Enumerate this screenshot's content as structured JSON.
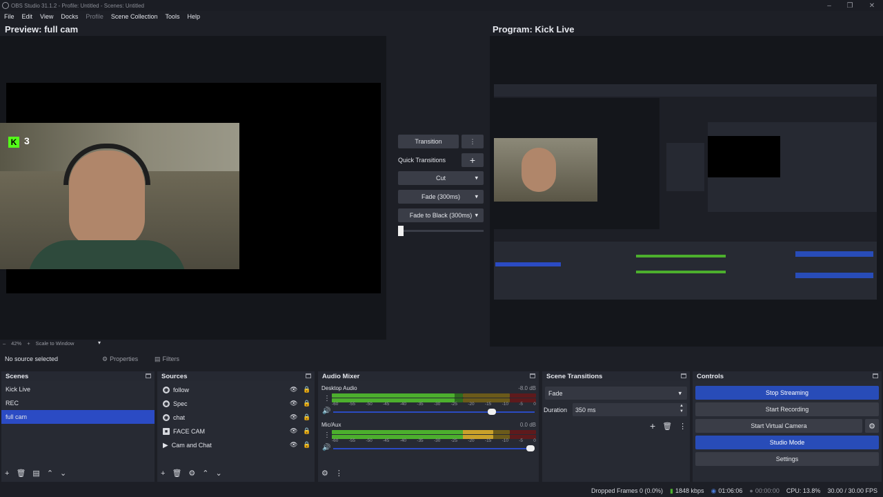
{
  "window": {
    "title": "OBS Studio 31.1.2 - Profile: Untitled - Scenes: Untitled"
  },
  "menu": {
    "items": [
      "File",
      "Edit",
      "View",
      "Docks",
      "Profile",
      "Scene Collection",
      "Tools",
      "Help"
    ]
  },
  "preview": {
    "label": "Preview: full cam",
    "zoom": "42%",
    "scale_mode": "Scale to Window",
    "overlay_count": "3"
  },
  "program": {
    "label": "Program: Kick Live"
  },
  "transitions_center": {
    "transition_button": "Transition",
    "quick_transitions_label": "Quick Transitions",
    "items": [
      "Cut",
      "Fade (300ms)",
      "Fade to Black (300ms)"
    ],
    "tbar_level": 0.0
  },
  "source_toolbar": {
    "status": "No source selected",
    "properties": "Properties",
    "filters": "Filters"
  },
  "scenes": {
    "title": "Scenes",
    "items": [
      "Kick Live",
      "REC",
      "full cam"
    ],
    "selected_index": 2
  },
  "sources": {
    "title": "Sources",
    "items": [
      {
        "name": "follow",
        "icon": "globe-icon"
      },
      {
        "name": "Spec",
        "icon": "globe-icon"
      },
      {
        "name": "chat",
        "icon": "globe-icon"
      },
      {
        "name": "FACE CAM",
        "icon": "camera-icon"
      },
      {
        "name": "Cam and Chat",
        "icon": "group-icon"
      }
    ]
  },
  "audio_mixer": {
    "title": "Audio Mixer",
    "ticks": [
      "-60",
      "-55",
      "-50",
      "-45",
      "-40",
      "-35",
      "-30",
      "-25",
      "-20",
      "-15",
      "-10",
      "-5",
      "0"
    ],
    "channels": [
      {
        "name": "Desktop Audio",
        "db": "-8.0 dB",
        "level": 0.6,
        "volume": 0.8
      },
      {
        "name": "Mic/Aux",
        "db": "0.0 dB",
        "level": 0.79,
        "volume": 1.0
      }
    ],
    "colors": {
      "green": "#4caf2d",
      "yellow": "#c9a12a",
      "red": "#a8262b"
    }
  },
  "scene_transitions": {
    "title": "Scene Transitions",
    "selected": "Fade",
    "duration_label": "Duration",
    "duration_value": "350 ms"
  },
  "controls": {
    "title": "Controls",
    "buttons": [
      {
        "label": "Stop Streaming",
        "active": true
      },
      {
        "label": "Start Recording",
        "active": false
      },
      {
        "label": "Start Virtual Camera",
        "active": false
      },
      {
        "label": "Studio Mode",
        "active": true
      },
      {
        "label": "Settings",
        "active": false
      }
    ]
  },
  "status_bar": {
    "dropped_frames": "Dropped Frames 0 (0.0%)",
    "bitrate": "1848 kbps",
    "stream_time": "01:06:06",
    "record_time": "00:00:00",
    "cpu": "CPU: 13.8%",
    "fps": "30.00 / 30.00 FPS"
  },
  "accent": "#284cb8"
}
